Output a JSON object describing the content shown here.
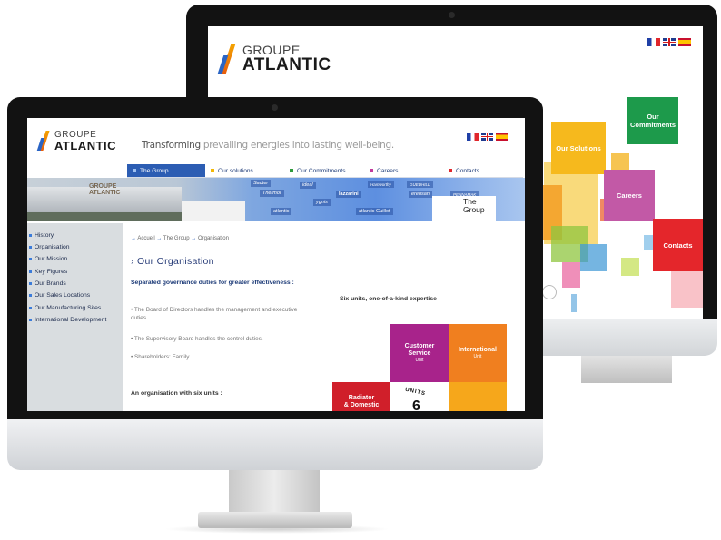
{
  "back_site": {
    "logo": {
      "line1": "GROUPE",
      "line2": "ATLANTIC"
    },
    "flags": [
      "fr-flag",
      "uk-flag",
      "es-flag"
    ],
    "tiles": {
      "commitments": "Our Commitments",
      "solutions": "Our Solutions",
      "careers": "Careers",
      "contacts": "Contacts"
    }
  },
  "front_site": {
    "logo": {
      "line1": "GROUPE",
      "line2": "ATLANTIC"
    },
    "tagline_word": "Transforming",
    "tagline_rest": " prevailing energies into lasting well-being.",
    "flags": [
      "fr-flag",
      "uk-flag",
      "es-flag"
    ],
    "nav": [
      {
        "label": "The Group",
        "color": "#2b5fb6",
        "active": true
      },
      {
        "label": "Our solutions",
        "color": "#f2b705",
        "active": false
      },
      {
        "label": "Our Commitments",
        "color": "#2e9a3c",
        "active": false
      },
      {
        "label": "Careers",
        "color": "#c13a9c",
        "active": false
      },
      {
        "label": "Contacts",
        "color": "#e0262b",
        "active": false
      }
    ],
    "banner": {
      "building_sign": "GROUPE ATLANTIC",
      "brands": [
        "Sauter",
        "ideal",
        "Thermor",
        "lazzarini",
        "ygnis",
        "erensan",
        "atlantic",
        "atlantic Guillot",
        "Hamworthy",
        "GUEDHILL",
        "PENNAMAK"
      ],
      "section_title_line1": "The",
      "section_title_line2": "Group"
    },
    "sidebar": [
      "History",
      "Organisation",
      "Our Mission",
      "Key Figures",
      "Our Brands",
      "Our Sales Locations",
      "Our Manufacturing Sites",
      "International Development"
    ],
    "breadcrumb": [
      "Accueil",
      "The Group",
      "Organisation"
    ],
    "page_title": "Our Organisation",
    "subtitle": "Separated governance duties for greater effectiveness :",
    "bullets": [
      "The Board of Directors handles the management and executive duties.",
      "The Supervisory Board handles the control duties.",
      "Shareholders: Family"
    ],
    "six_units_heading": "Six units, one-of-a-kind expertise",
    "six_units_intro": "An organisation with six units :",
    "units": {
      "customer_service": {
        "name": "Customer Service",
        "sub": "Unit"
      },
      "international": {
        "name": "International",
        "sub": "Unit"
      },
      "radiator": {
        "name": "Radiator",
        "sub": "& Domestic"
      },
      "center_label": "UNITS",
      "center_number": "6"
    }
  }
}
